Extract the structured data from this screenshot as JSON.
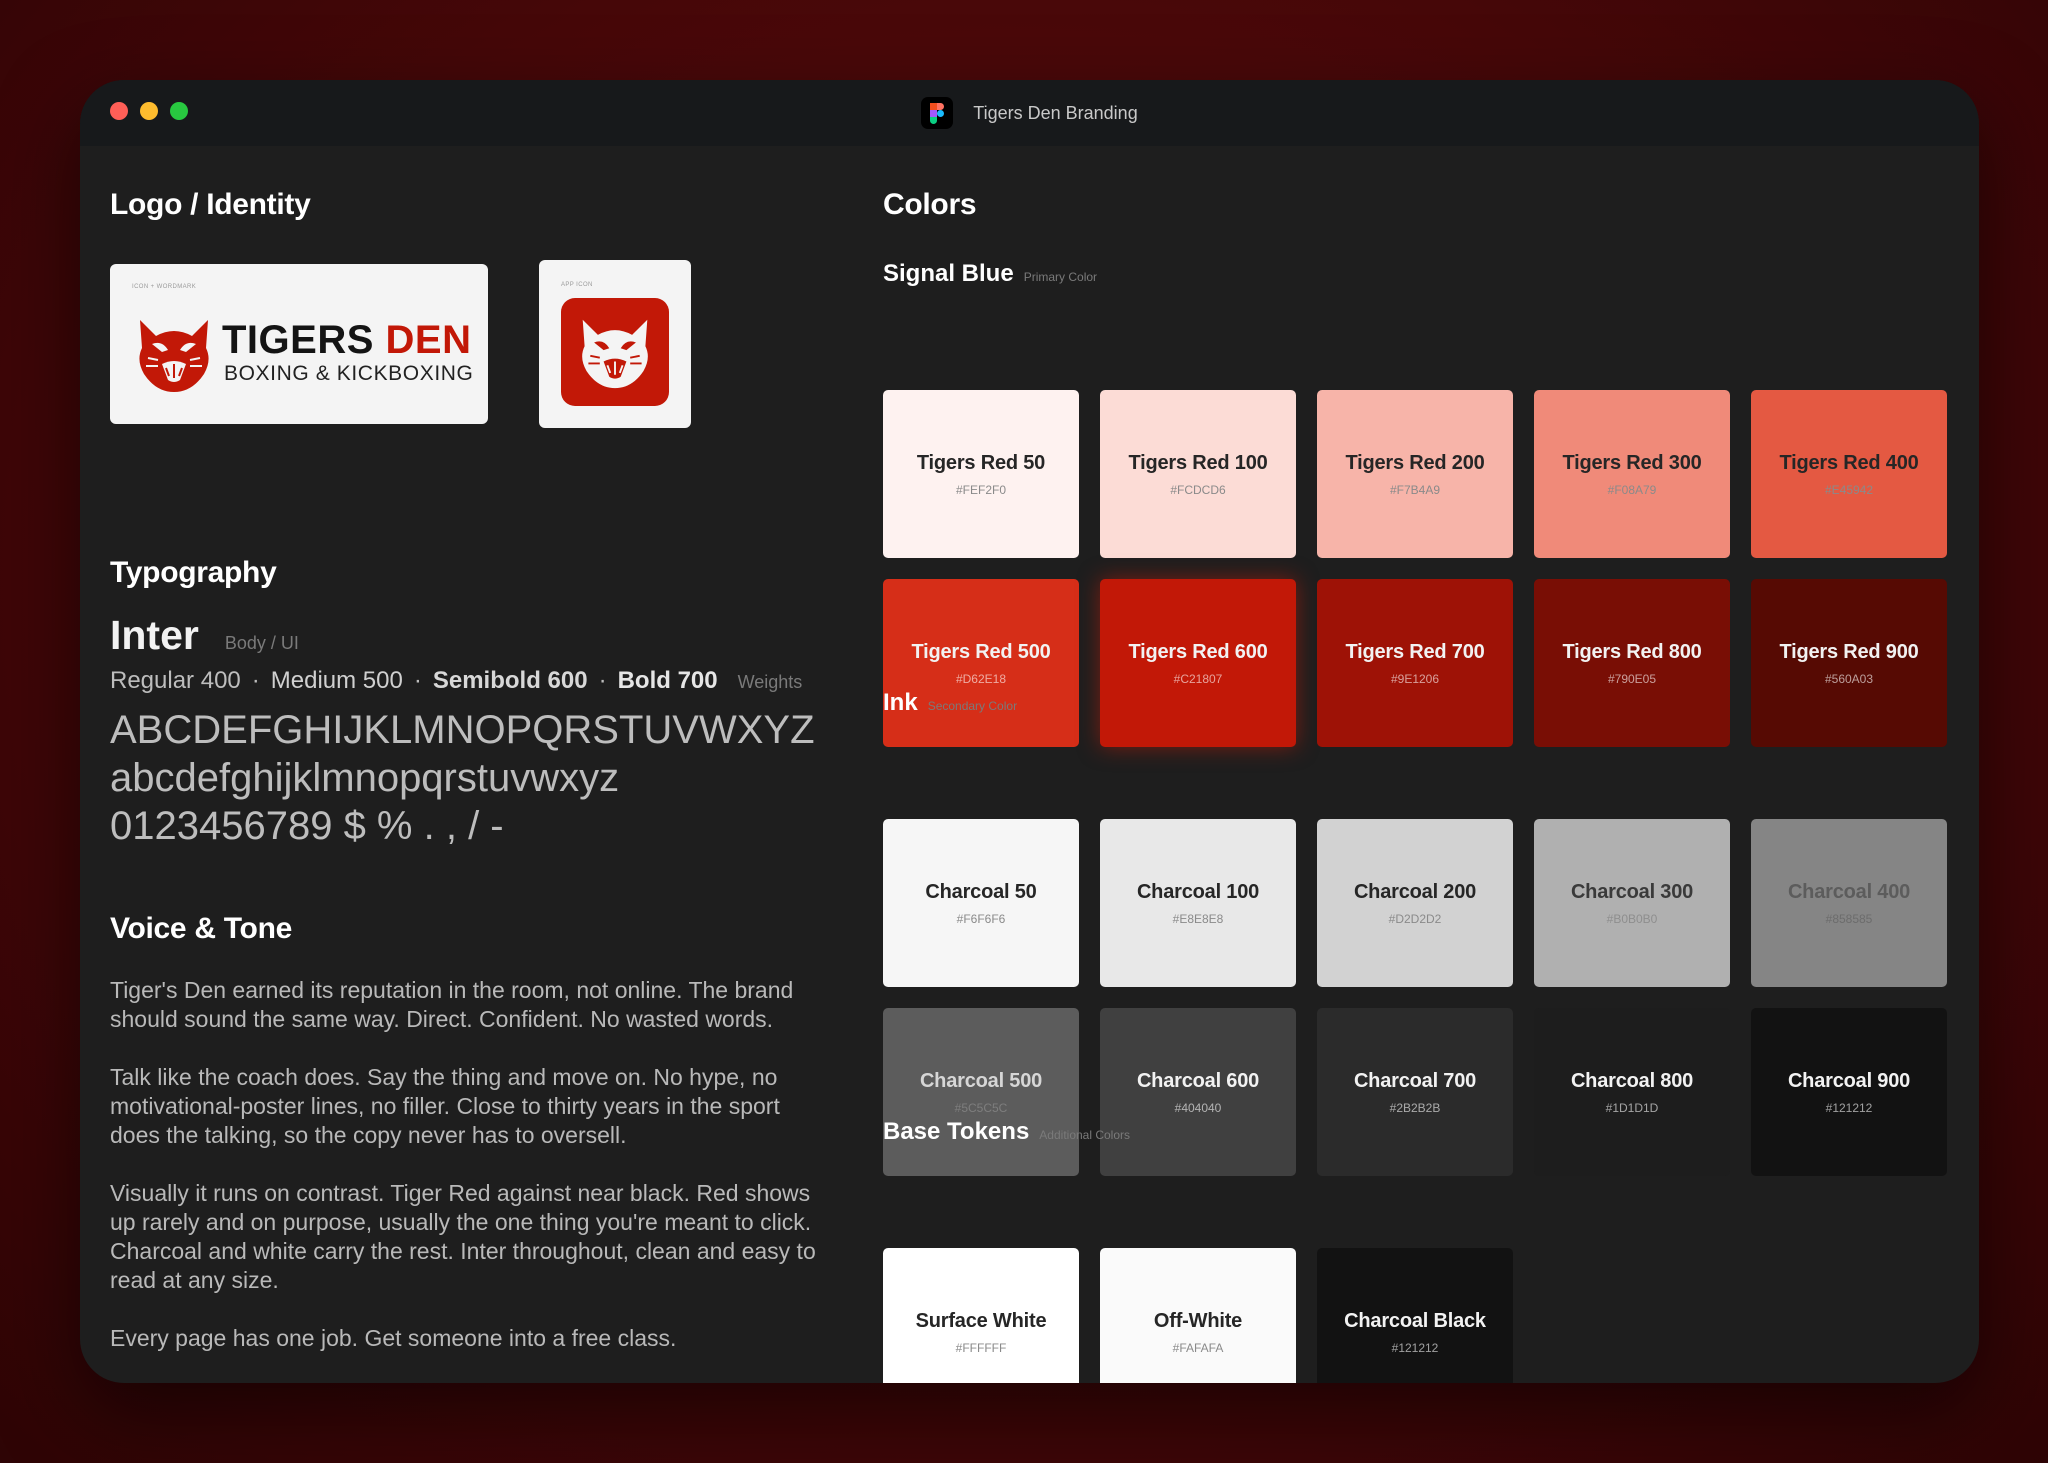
{
  "window": {
    "title": "Tigers Den Branding"
  },
  "logo": {
    "section_title": "Logo / Identity",
    "wordmark_tag": "ICON + WORDMARK",
    "wordmark_main": "TIGERS",
    "wordmark_accent": "DEN",
    "wordmark_sub": "BOXING & KICKBOXING",
    "appicon_tag": "APP ICON"
  },
  "typography": {
    "section_title": "Typography",
    "font_name": "Inter",
    "font_role": "Body / UI",
    "weights": [
      "Regular 400",
      "Medium 500",
      "Semibold 600",
      "Bold 700"
    ],
    "separator": "·",
    "weights_label": "Weights",
    "specimen_upper": "ABCDEFGHIJKLMNOPQRSTUVWXYZ",
    "specimen_lower": "abcdefghijklmnopqrstuvwxyz",
    "specimen_numbers": "0123456789 $ % . , / -"
  },
  "voice": {
    "section_title": "Voice & Tone",
    "paragraphs": [
      "Tiger's Den earned its reputation in the room, not online. The brand should sound the same way. Direct. Confident. No wasted words.",
      "Talk like the coach does. Say the thing and move on. No hype, no motivational-poster lines, no filler. Close to thirty years in the sport does the talking, so the copy never has to oversell.",
      "Visually it runs on contrast. Tiger Red against near black. Red shows up rarely and on purpose, usually the one thing you're meant to click. Charcoal and white carry the rest. Inter throughout, clean and easy to read at any size.",
      "Every page has one job. Get someone into a free class."
    ]
  },
  "colors": {
    "section_title": "Colors",
    "groups": [
      {
        "name": "Signal Blue",
        "subtitle": "Primary Color",
        "swatches": [
          {
            "name": "Tigers Red 50",
            "hex": "#FEF2F0"
          },
          {
            "name": "Tigers Red 100",
            "hex": "#FCDCD6"
          },
          {
            "name": "Tigers Red 200",
            "hex": "#F7B4A9"
          },
          {
            "name": "Tigers Red 300",
            "hex": "#F08A79"
          },
          {
            "name": "Tigers Red 400",
            "hex": "#E45942"
          },
          {
            "name": "Tigers Red 500",
            "hex": "#D62E18"
          },
          {
            "name": "Tigers Red 600",
            "hex": "#C21807"
          },
          {
            "name": "Tigers Red 700",
            "hex": "#9E1206"
          },
          {
            "name": "Tigers Red 800",
            "hex": "#790E05"
          },
          {
            "name": "Tigers Red 900",
            "hex": "#560A03"
          }
        ]
      },
      {
        "name": "Ink",
        "subtitle": "Secondary Color",
        "swatches": [
          {
            "name": "Charcoal 50",
            "hex": "#F6F6F6"
          },
          {
            "name": "Charcoal 100",
            "hex": "#E8E8E8"
          },
          {
            "name": "Charcoal 200",
            "hex": "#D2D2D2"
          },
          {
            "name": "Charcoal 300",
            "hex": "#B0B0B0"
          },
          {
            "name": "Charcoal 400",
            "hex": "#858585"
          },
          {
            "name": "Charcoal 500",
            "hex": "#5C5C5C"
          },
          {
            "name": "Charcoal 600",
            "hex": "#404040"
          },
          {
            "name": "Charcoal 700",
            "hex": "#2B2B2B"
          },
          {
            "name": "Charcoal 800",
            "hex": "#1D1D1D"
          },
          {
            "name": "Charcoal 900",
            "hex": "#121212"
          }
        ]
      },
      {
        "name": "Base Tokens",
        "subtitle": "Additional Colors",
        "swatches": [
          {
            "name": "Surface White",
            "hex": "#FFFFFF"
          },
          {
            "name": "Off-White",
            "hex": "#FAFAFA"
          },
          {
            "name": "Charcoal Black",
            "hex": "#121212"
          }
        ]
      }
    ]
  },
  "icons": {
    "window_controls": [
      "close-light",
      "minimize-light",
      "zoom-light"
    ],
    "app": "figma-icon",
    "logo_mark": "tiger-head-icon"
  },
  "accent_color": "#C21807"
}
